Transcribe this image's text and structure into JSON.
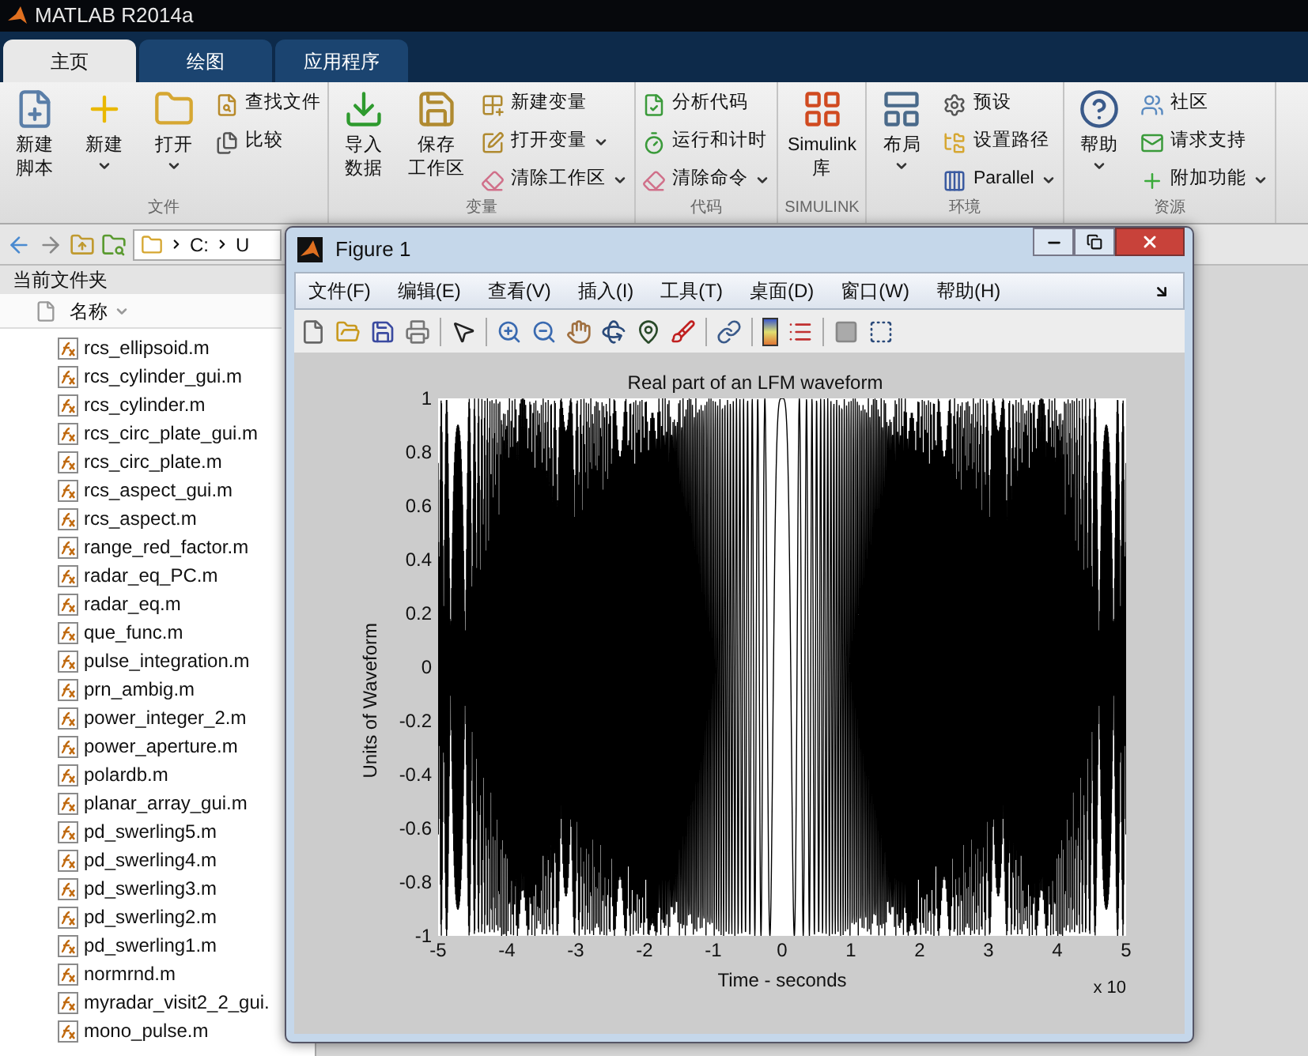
{
  "window": {
    "title": "MATLAB R2014a"
  },
  "tabs": [
    {
      "label": "主页",
      "selected": true
    },
    {
      "label": "绘图",
      "selected": false
    },
    {
      "label": "应用程序",
      "selected": false
    }
  ],
  "ribbon": {
    "groups": [
      {
        "label": "文件",
        "items": [
          {
            "kind": "large",
            "lines": [
              "新建",
              "脚本"
            ],
            "dropdown": false
          },
          {
            "kind": "large",
            "lines": [
              "新建"
            ],
            "dropdown": true
          },
          {
            "kind": "large",
            "lines": [
              "打开"
            ],
            "dropdown": true
          },
          {
            "kind": "small",
            "lines": [
              "查找文件"
            ],
            "dropdown": false
          },
          {
            "kind": "small",
            "lines": [
              "比较"
            ],
            "dropdown": false
          }
        ]
      },
      {
        "label": "变量",
        "items": [
          {
            "kind": "large",
            "lines": [
              "导入",
              "数据"
            ],
            "dropdown": false
          },
          {
            "kind": "large",
            "lines": [
              "保存",
              "工作区"
            ],
            "dropdown": false
          },
          {
            "kind": "small",
            "lines": [
              "新建变量"
            ],
            "dropdown": false
          },
          {
            "kind": "small",
            "lines": [
              "打开变量"
            ],
            "dropdown": true
          },
          {
            "kind": "small",
            "lines": [
              "清除工作区"
            ],
            "dropdown": true
          }
        ]
      },
      {
        "label": "代码",
        "items": [
          {
            "kind": "small",
            "lines": [
              "分析代码"
            ],
            "dropdown": false
          },
          {
            "kind": "small",
            "lines": [
              "运行和计时"
            ],
            "dropdown": false
          },
          {
            "kind": "small",
            "lines": [
              "清除命令"
            ],
            "dropdown": true
          }
        ]
      },
      {
        "label": "SIMULINK",
        "items": [
          {
            "kind": "large",
            "lines": [
              "Simulink",
              "库"
            ],
            "dropdown": false
          }
        ]
      },
      {
        "label": "环境",
        "items": [
          {
            "kind": "large",
            "lines": [
              "布局"
            ],
            "dropdown": true
          },
          {
            "kind": "small",
            "lines": [
              "预设"
            ],
            "dropdown": false
          },
          {
            "kind": "small",
            "lines": [
              "设置路径"
            ],
            "dropdown": false
          },
          {
            "kind": "small",
            "lines": [
              "Parallel"
            ],
            "dropdown": true
          }
        ]
      },
      {
        "label": "资源",
        "items": [
          {
            "kind": "large",
            "lines": [
              "帮助"
            ],
            "dropdown": true
          },
          {
            "kind": "small",
            "lines": [
              "社区"
            ],
            "dropdown": false
          },
          {
            "kind": "small",
            "lines": [
              "请求支持"
            ],
            "dropdown": false
          },
          {
            "kind": "small",
            "lines": [
              "附加功能"
            ],
            "dropdown": true
          }
        ]
      }
    ]
  },
  "address_bar": {
    "path": [
      "C:",
      "U"
    ]
  },
  "current_folder": {
    "title": "当前文件夹",
    "column": "名称",
    "files": [
      "rcs_ellipsoid.m",
      "rcs_cylinder_gui.m",
      "rcs_cylinder.m",
      "rcs_circ_plate_gui.m",
      "rcs_circ_plate.m",
      "rcs_aspect_gui.m",
      "rcs_aspect.m",
      "range_red_factor.m",
      "radar_eq_PC.m",
      "radar_eq.m",
      "que_func.m",
      "pulse_integration.m",
      "prn_ambig.m",
      "power_integer_2.m",
      "power_aperture.m",
      "polardb.m",
      "planar_array_gui.m",
      "pd_swerling5.m",
      "pd_swerling4.m",
      "pd_swerling3.m",
      "pd_swerling2.m",
      "pd_swerling1.m",
      "normrnd.m",
      "myradar_visit2_2_gui.",
      "mono_pulse.m"
    ]
  },
  "figure": {
    "title": "Figure 1",
    "menu": [
      "文件(F)",
      "编辑(E)",
      "查看(V)",
      "插入(I)",
      "工具(T)",
      "桌面(D)",
      "窗口(W)",
      "帮助(H)"
    ],
    "plot": {
      "title": "Real part of an LFM waveform",
      "xlabel": "Time - seconds",
      "ylabel": "Units of Waveform",
      "xticks": [
        "-5",
        "-4",
        "-3",
        "-2",
        "-1",
        "0",
        "1",
        "2",
        "3",
        "4",
        "5"
      ],
      "yticks": [
        "1",
        "0.8",
        "0.6",
        "0.4",
        "0.2",
        "0",
        "-0.2",
        "-0.4",
        "-0.6",
        "-0.8",
        "-1"
      ],
      "x_exponent": "x 10"
    }
  }
}
